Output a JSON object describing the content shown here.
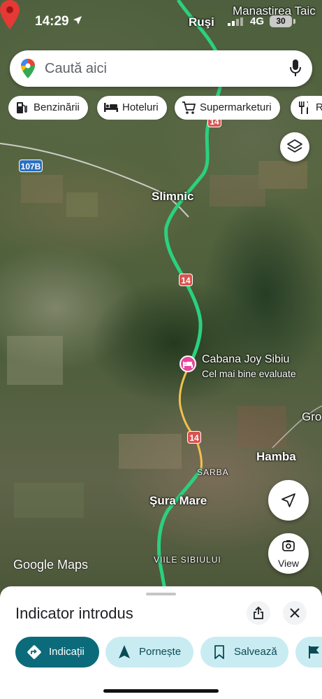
{
  "status_bar": {
    "time": "14:29",
    "network": "4G",
    "battery": "30"
  },
  "search": {
    "placeholder": "Caută aici"
  },
  "chips": [
    {
      "label": "Benzinării",
      "icon": "gas-station-icon"
    },
    {
      "label": "Hoteluri",
      "icon": "bed-icon"
    },
    {
      "label": "Supermarketuri",
      "icon": "cart-icon"
    },
    {
      "label": "R",
      "icon": "restaurant-icon"
    }
  ],
  "map": {
    "labels": {
      "manastirea": "Manastirea Taic",
      "rusi": "Ruşi",
      "slimnic": "Slimnic",
      "poi_name": "Cabana Joy Sibiu",
      "poi_sub": "Cel mai bine evaluate",
      "gro": "Gro",
      "hamba": "Hamba",
      "sarba": "SARBA",
      "sura_mare": "Şura Mare",
      "viile_sibiului": "VIILE SIBIULUI"
    },
    "shields": {
      "road_107b": "107B",
      "road_14": "14"
    },
    "poi_color": "#e8489a",
    "route_color": "#2bd17e",
    "pin_color": "#e53935"
  },
  "buttons": {
    "view_label": "View"
  },
  "attribution": "Google Maps",
  "sheet": {
    "title": "Indicator introdus",
    "actions": {
      "directions": "Indicații",
      "start": "Pornește",
      "save": "Salvează"
    }
  },
  "colors": {
    "primary_action": "#0b6b7a",
    "secondary_action": "#c9ecf2"
  }
}
